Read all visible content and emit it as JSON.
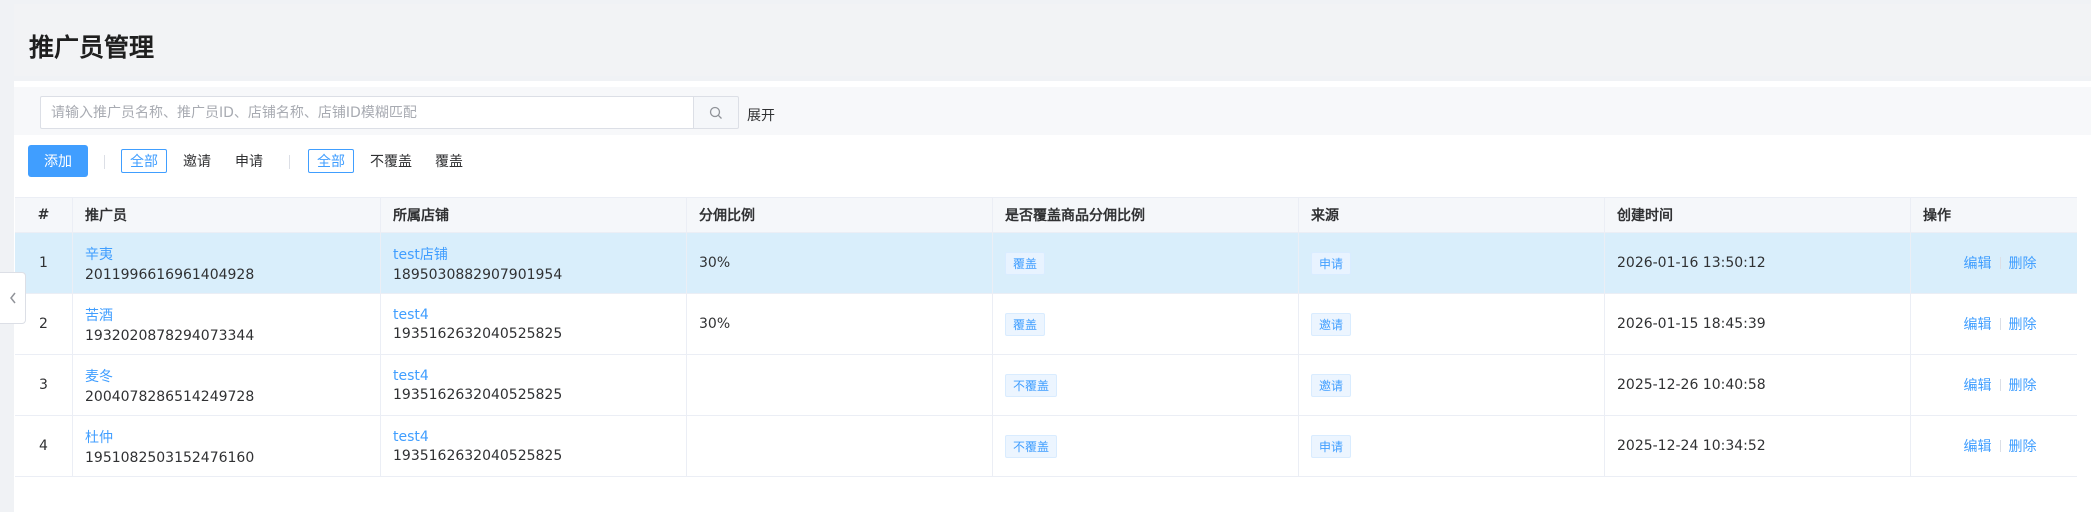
{
  "page": {
    "title": "推广员管理"
  },
  "search": {
    "placeholder": "请输入推广员名称、推广员ID、店铺名称、店铺ID模糊匹配",
    "value": "",
    "expand_label": "展开"
  },
  "toolbar": {
    "add_label": "添加",
    "filter_type": {
      "options": [
        "全部",
        "邀请",
        "申请"
      ],
      "selected": "全部"
    },
    "filter_cover": {
      "options": [
        "全部",
        "不覆盖",
        "覆盖"
      ],
      "selected": "全部"
    }
  },
  "table": {
    "columns": [
      "#",
      "推广员",
      "所属店铺",
      "分佣比例",
      "是否覆盖商品分佣比例",
      "来源",
      "创建时间",
      "操作"
    ],
    "rows": [
      {
        "index": "1",
        "name": "辛夷",
        "promoter_id": "2011996616961404928",
        "shop_name": "test店铺",
        "shop_id": "1895030882907901954",
        "ratio": "30%",
        "cover": "覆盖",
        "source": "申请",
        "created": "2026-01-16 13:50:12",
        "selected": true
      },
      {
        "index": "2",
        "name": "苦酒",
        "promoter_id": "1932020878294073344",
        "shop_name": "test4",
        "shop_id": "1935162632040525825",
        "ratio": "30%",
        "cover": "覆盖",
        "source": "邀请",
        "created": "2026-01-15 18:45:39",
        "selected": false
      },
      {
        "index": "3",
        "name": "麦冬",
        "promoter_id": "2004078286514249728",
        "shop_name": "test4",
        "shop_id": "1935162632040525825",
        "ratio": "",
        "cover": "不覆盖",
        "source": "邀请",
        "created": "2025-12-26 10:40:58",
        "selected": false
      },
      {
        "index": "4",
        "name": "杜仲",
        "promoter_id": "1951082503152476160",
        "shop_name": "test4",
        "shop_id": "1935162632040525825",
        "ratio": "",
        "cover": "不覆盖",
        "source": "申请",
        "created": "2025-12-24 10:34:52",
        "selected": false
      }
    ],
    "actions": {
      "edit": "编辑",
      "delete": "删除"
    }
  },
  "icons": {
    "search": "search-icon",
    "collapse": "chevron-left-icon"
  }
}
